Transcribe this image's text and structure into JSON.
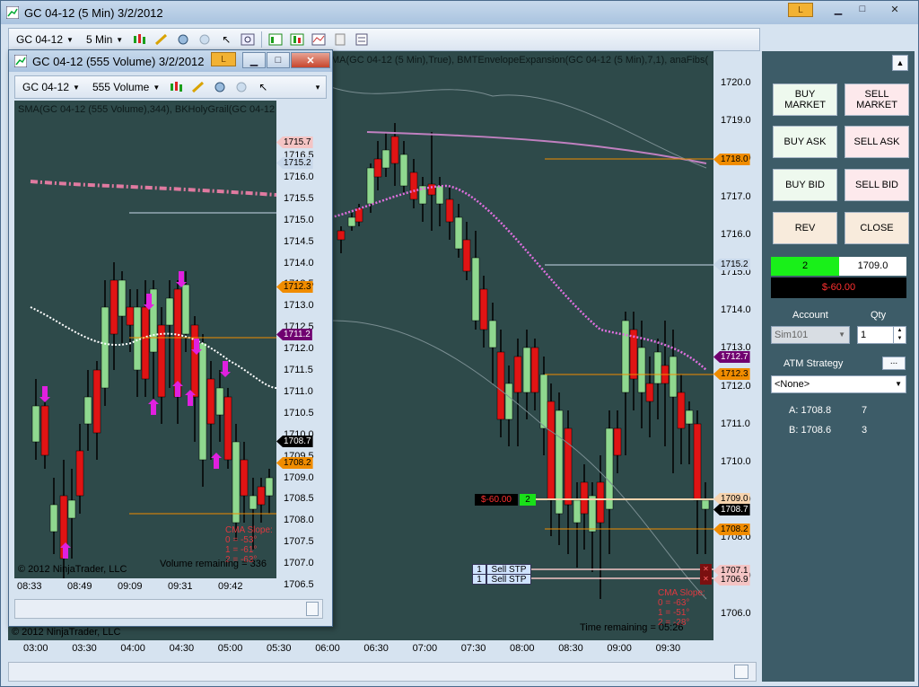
{
  "main_window": {
    "title": "GC 04-12 (5 Min)  3/2/2012",
    "link_button": "L",
    "instrument": "GC 04-12",
    "interval": "5 Min",
    "indicator_label": "MA(GC 04-12 (5 Min),True), BMTEnvelopeExpansion(GC 04-12 (5 Min),7,1), anaFibs(",
    "y_ticks": [
      "1720.0",
      "1719.0",
      "1718.0",
      "1717.0",
      "1716.0",
      "1715.0",
      "1714.0",
      "1713.0",
      "1712.0",
      "1711.0",
      "1710.0",
      "1709.0",
      "1708.0",
      "1707.0",
      "1706.0"
    ],
    "x_ticks": [
      "03:00",
      "03:30",
      "04:00",
      "04:30",
      "05:00",
      "05:30",
      "06:00",
      "06:30",
      "07:00",
      "07:30",
      "08:00",
      "08:30",
      "09:00",
      "09:30"
    ],
    "price_tags": {
      "t1718": "1718.0",
      "t1715": "1715.2",
      "t1712_7": "1712.7",
      "t1712_3": "1712.3",
      "t1709": "1709.0",
      "t1708_7": "1708.7",
      "t1708_2": "1708.2",
      "t1707_1": "1707.1",
      "t1706_9": "1706.9"
    },
    "position_pnl": "$-60.00",
    "position_qty": "2",
    "orders": [
      {
        "qty": "1",
        "type": "Sell STP"
      },
      {
        "qty": "1",
        "type": "Sell STP"
      }
    ],
    "cma_title": "CMA Slope:",
    "cma_lines": [
      "0 = -63°",
      "1 = -51°",
      "2 = -28°"
    ],
    "time_remaining": "Time remaining = 05:26",
    "copyright": "© 2012 NinjaTrader, LLC"
  },
  "sub_window": {
    "title": "GC 04-12 (555 Volume)  3/2/2012",
    "link_button": "L",
    "instrument": "GC 04-12",
    "interval": "555 Volume",
    "indicator_label": "SMA(GC 04-12 (555 Volume),344), BKHolyGrail(GC 04-12 (",
    "y_ticks": [
      "1716.5",
      "1716.0",
      "1715.5",
      "1715.0",
      "1714.5",
      "1714.0",
      "1713.5",
      "1713.0",
      "1712.5",
      "1712.0",
      "1711.5",
      "1711.0",
      "1710.5",
      "1710.0",
      "1709.5",
      "1709.0",
      "1708.5",
      "1708.0",
      "1707.5",
      "1707.0",
      "1706.5",
      "1706.0"
    ],
    "x_ticks": [
      "08:33",
      "08:49",
      "09:09",
      "09:31",
      "09:42"
    ],
    "price_tags": {
      "t1715_7": "1715.7",
      "t1715_2": "1715.2",
      "t1712_3": "1712.3",
      "t1711_2": "1711.2",
      "t1708_7": "1708.7",
      "t1708_2": "1708.2"
    },
    "cma_title": "CMA Slope:",
    "cma_lines": [
      "0 = -53°",
      "1 = -61°",
      "2 = -63°"
    ],
    "volume_remaining": "Volume remaining = 336",
    "copyright": "© 2012 NinjaTrader, LLC"
  },
  "order_panel": {
    "buy_market": "BUY\nMARKET",
    "sell_market": "SELL\nMARKET",
    "buy_ask": "BUY ASK",
    "sell_ask": "SELL ASK",
    "buy_bid": "BUY BID",
    "sell_bid": "SELL BID",
    "rev": "REV",
    "close": "CLOSE",
    "position_qty": "2",
    "position_price": "1709.0",
    "pnl": "$-60.00",
    "account_label": "Account",
    "qty_label": "Qty",
    "account_value": "Sim101",
    "qty_value": "1",
    "atm_label": "ATM Strategy",
    "atm_button": "...",
    "atm_value": "<None>",
    "stops": [
      {
        "label": "A: 1708.8",
        "qty": "7"
      },
      {
        "label": "B: 1708.6",
        "qty": "3"
      }
    ]
  },
  "colors": {
    "up": "#8fd88f",
    "down": "#e01414",
    "plot_bg": "#2e4a4a",
    "ma": "#e070e0",
    "accent_orange": "#f08c00"
  }
}
